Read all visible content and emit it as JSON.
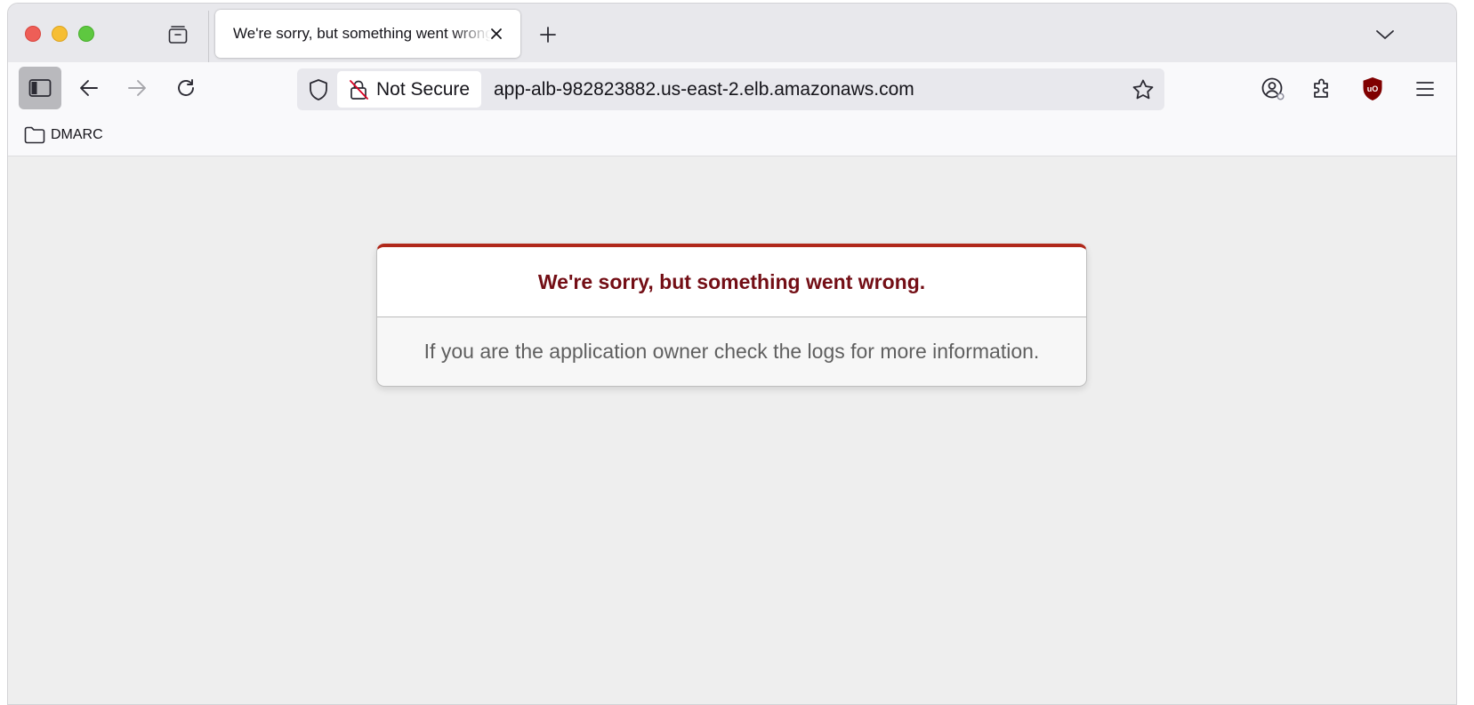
{
  "browser": {
    "tab": {
      "title": "We're sorry, but something went wrong"
    },
    "urlbar": {
      "security_label": "Not Secure",
      "url": "app-alb-982823882.us-east-2.elb.amazonaws.com"
    },
    "bookmarks": [
      {
        "label": "DMARC"
      }
    ],
    "icons": {
      "sidebar": "sidebar-icon",
      "back": "back-arrow-icon",
      "forward": "forward-arrow-icon",
      "reload": "reload-icon",
      "shield": "tracking-shield-icon",
      "lock": "insecure-lock-icon",
      "bookmark_star": "star-icon",
      "account": "account-icon",
      "extensions": "puzzle-icon",
      "ublock": "ublock-origin-icon",
      "menu": "hamburger-icon"
    }
  },
  "page": {
    "error_title": "We're sorry, but something went wrong.",
    "error_message": "If you are the application owner check the logs for more information."
  },
  "colors": {
    "error_accent": "#b0281a",
    "error_title": "#730e15"
  }
}
